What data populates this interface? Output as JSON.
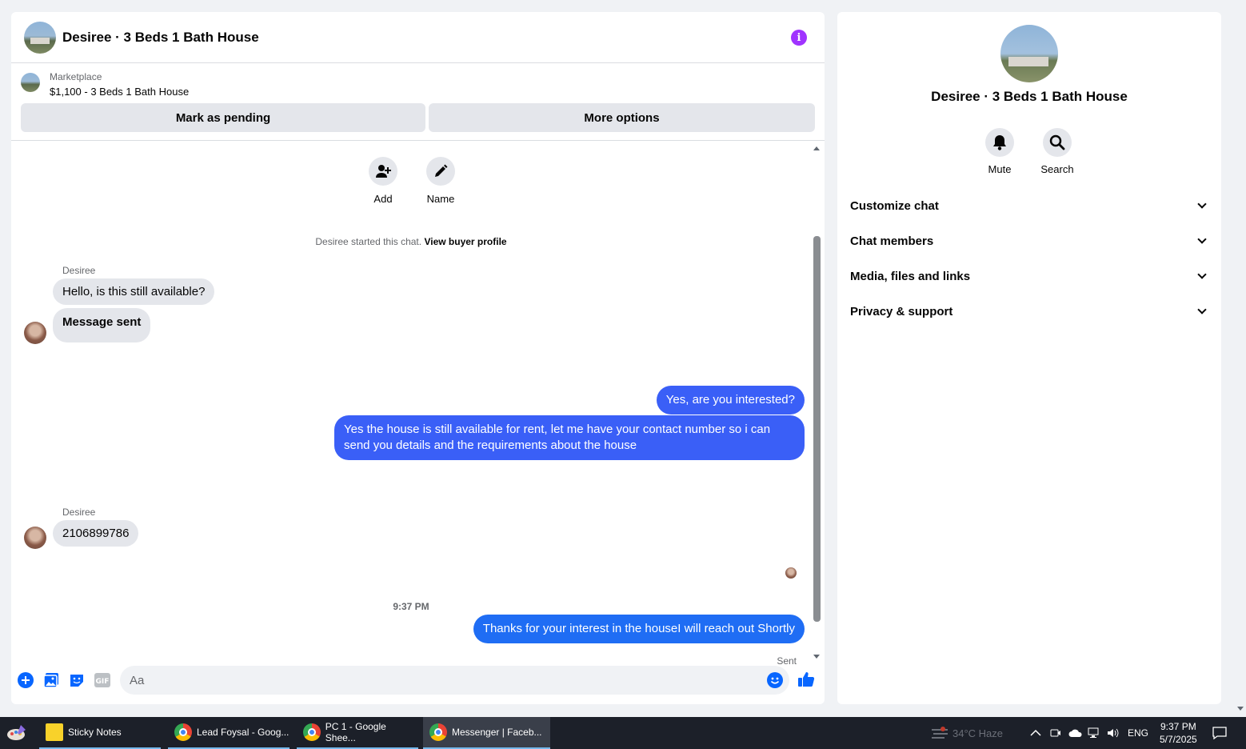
{
  "chat": {
    "title": "Desiree · 3 Beds 1 Bath House",
    "marketplace_label": "Marketplace",
    "listing": "$1,100 - 3 Beds 1 Bath House",
    "mark_pending": "Mark as pending",
    "more_options": "More options",
    "add_label": "Add",
    "name_label": "Name",
    "system_text": "Desiree started this chat.",
    "system_link": "View buyer profile",
    "messages": [
      {
        "sender": "Desiree",
        "text": "Hello, is this still available?"
      },
      {
        "text": "Message sent"
      },
      {
        "out": true,
        "text": "Yes, are you interested?"
      },
      {
        "out": true,
        "text": "Yes the house is still available for rent, let me have your contact number so i can send you details and the requirements about the house"
      },
      {
        "sender": "Desiree",
        "text": "2106899786"
      },
      {
        "out": true,
        "text": "Thanks for your interest in the houseI will reach out Shortly"
      }
    ],
    "timestamp": "9:37 PM",
    "sent_label": "Sent",
    "composer_placeholder": "Aa"
  },
  "info": {
    "title": "Desiree · 3 Beds 1 Bath House",
    "mute_label": "Mute",
    "search_label": "Search",
    "sections": [
      "Customize chat",
      "Chat members",
      "Media, files and links",
      "Privacy & support"
    ]
  },
  "taskbar": {
    "apps": [
      "Sticky Notes",
      "Lead Foysal - Goog...",
      "PC 1 - Google Shee...",
      "Messenger | Faceb..."
    ],
    "weather": "34°C  Haze",
    "language": "ENG",
    "time": "9:37 PM",
    "date": "5/7/2025"
  },
  "colors": {
    "accent": "#0866ff",
    "bubble_out": "#3b5bf6",
    "info_icon": "#a033ff",
    "taskbar": "#1c2029"
  }
}
